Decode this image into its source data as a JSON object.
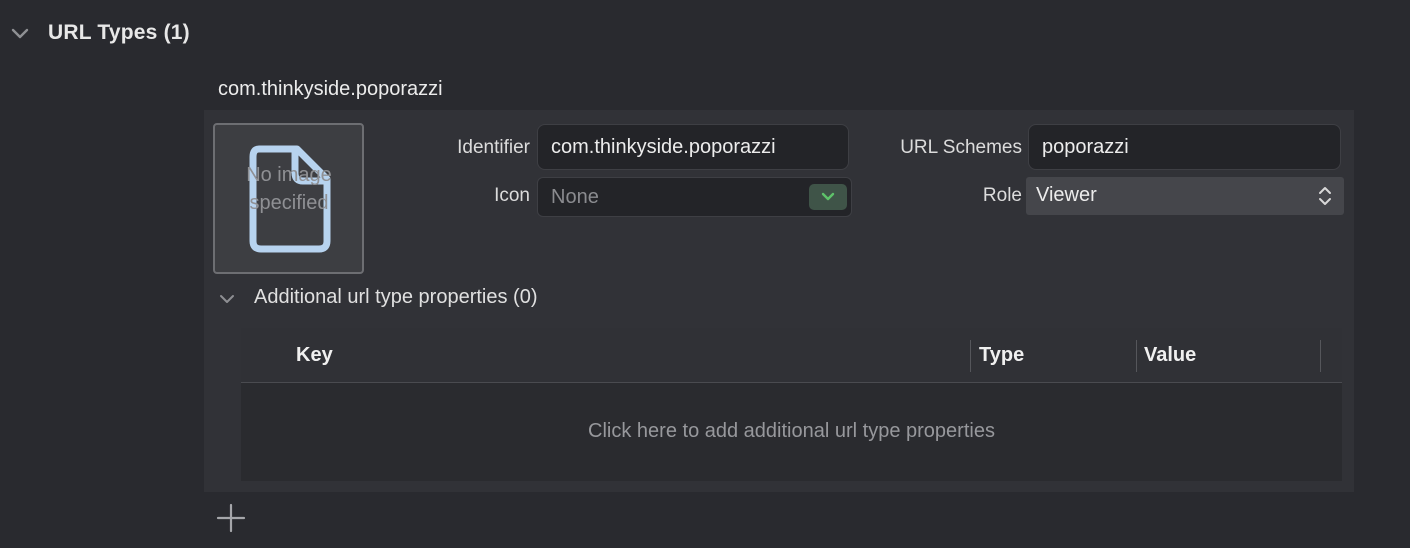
{
  "section": {
    "title": "URL Types (1)"
  },
  "entry": {
    "title": "com.thinkyside.poporazzi",
    "image_well": {
      "placeholder": "No image specified"
    },
    "fields": {
      "identifier_label": "Identifier",
      "identifier_value": "com.thinkyside.poporazzi",
      "icon_label": "Icon",
      "icon_value": "None",
      "url_schemes_label": "URL Schemes",
      "url_schemes_value": "poporazzi",
      "role_label": "Role",
      "role_value": "Viewer"
    },
    "additional": {
      "title": "Additional url type properties (0)",
      "columns": [
        "Key",
        "Type",
        "Value"
      ],
      "empty_text": "Click here to add additional url type properties"
    }
  },
  "icons": {
    "section_chevron": "chevron-down-icon",
    "doc": "document-icon",
    "combo": "chevron-down-icon",
    "popup": "up-down-arrows-icon",
    "add": "plus-icon"
  },
  "colors": {
    "background": "#292a2f",
    "panel": "#313237",
    "accent_green": "#5ec26a"
  }
}
